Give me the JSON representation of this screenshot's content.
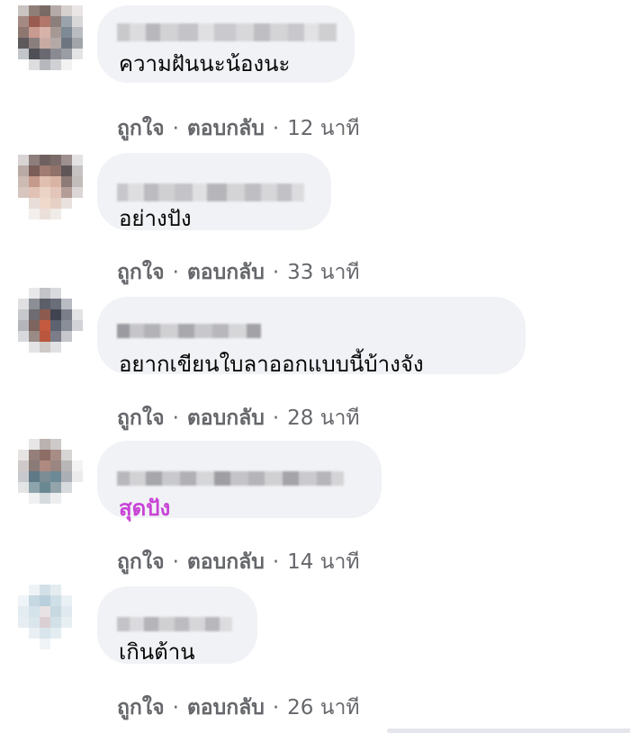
{
  "comments": [
    {
      "text": "ความฝันนะน้องนะ",
      "highlight": false,
      "like": "ถูกใจ",
      "separator": "·",
      "reply": "ตอบกลับ",
      "time": "12 นาที"
    },
    {
      "text": "อย่างปัง",
      "highlight": false,
      "like": "ถูกใจ",
      "separator": "·",
      "reply": "ตอบกลับ",
      "time": "33 นาที"
    },
    {
      "text": "อยากเขียนใบลาออกแบบนี้บ้างจัง",
      "highlight": false,
      "like": "ถูกใจ",
      "separator": "·",
      "reply": "ตอบกลับ",
      "time": "28 นาที"
    },
    {
      "text": "สุดปัง",
      "highlight": true,
      "like": "ถูกใจ",
      "separator": "·",
      "reply": "ตอบกลับ",
      "time": "14 นาที"
    },
    {
      "text": "เกินต้าน",
      "highlight": false,
      "like": "ถูกใจ",
      "separator": "·",
      "reply": "ตอบกลับ",
      "time": "26 นาที"
    }
  ],
  "colors": {
    "bubble": "#f0f2f5",
    "meta_text": "#65676b",
    "highlight_text": "#c842d6"
  }
}
